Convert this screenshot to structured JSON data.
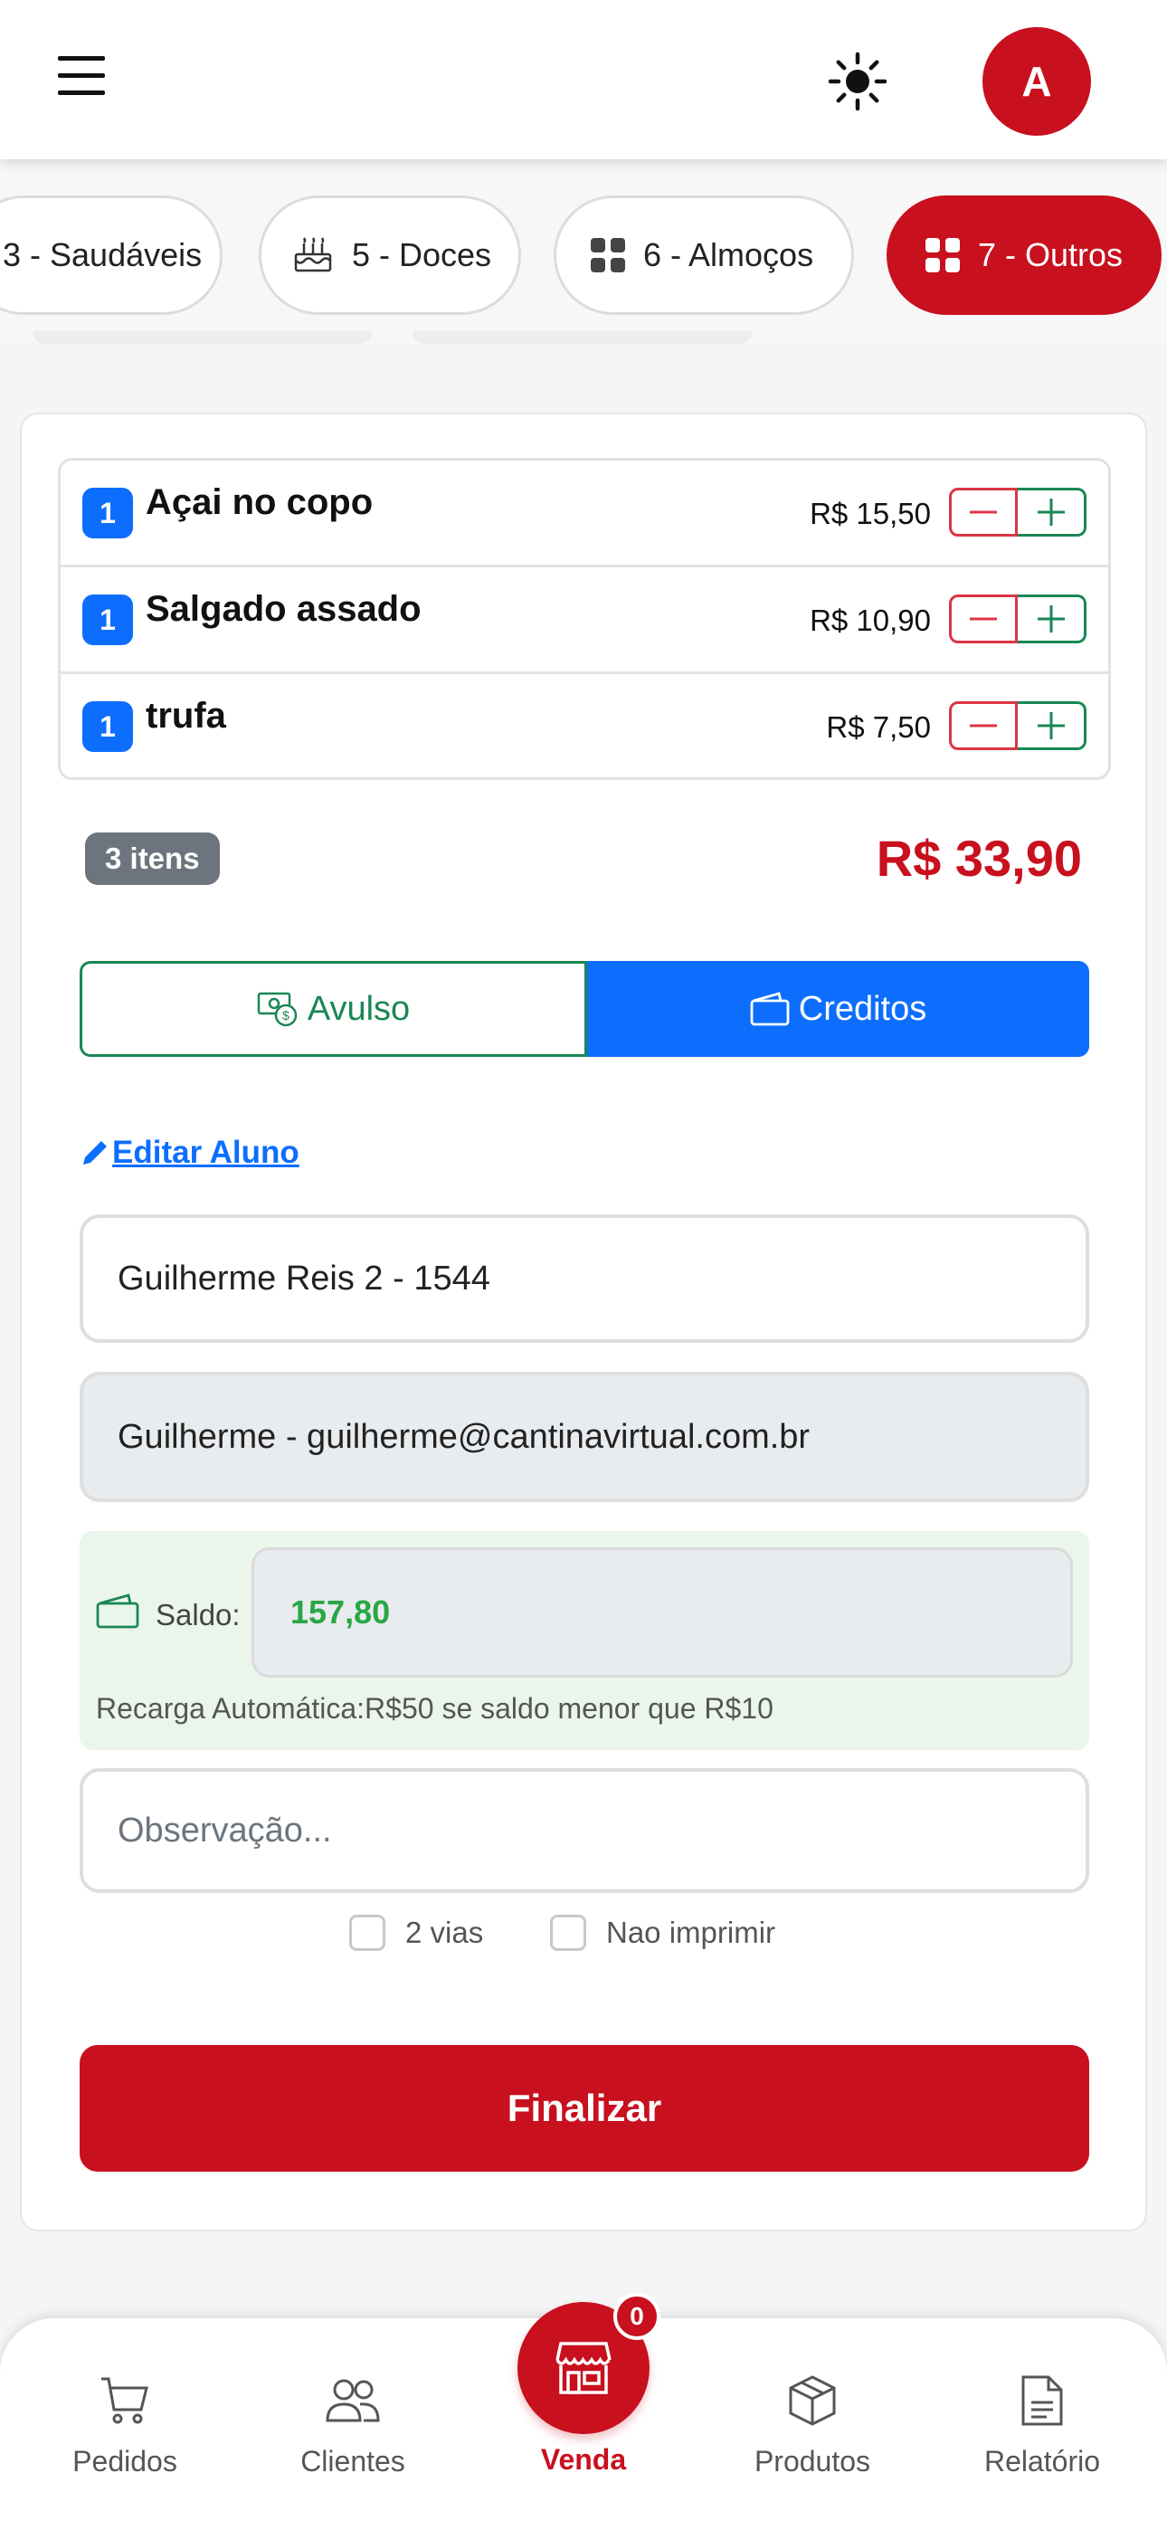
{
  "header": {
    "avatar_initial": "A",
    "menu_icon": "hamburger-icon",
    "theme_icon": "sun-icon"
  },
  "categories": [
    {
      "label": "3 - Saudáveis",
      "icon": "",
      "active": false
    },
    {
      "label": "5 - Doces",
      "icon": "cake-icon",
      "active": false
    },
    {
      "label": "6 - Almoços",
      "icon": "grid-icon",
      "active": false
    },
    {
      "label": "7 - Outros",
      "icon": "grid-icon",
      "active": true
    }
  ],
  "cart": {
    "items": [
      {
        "qty": "1",
        "name": "Açai no copo",
        "price": "R$ 15,50"
      },
      {
        "qty": "1",
        "name": "Salgado assado",
        "price": "R$ 10,90"
      },
      {
        "qty": "1",
        "name": "trufa",
        "price": "R$ 7,50"
      }
    ],
    "count_label": "3 itens",
    "total": "R$ 33,90"
  },
  "payment": {
    "avulso_label": "Avulso",
    "creditos_label": "Creditos",
    "selected": "Creditos"
  },
  "student": {
    "edit_link": "Editar Aluno",
    "name_value": "Guilherme Reis 2 - 1544",
    "guardian_value": "Guilherme  - guilherme@cantinavirtual.com.br",
    "saldo_label": "Saldo:",
    "saldo_value": "157,80",
    "recarga_text": "Recarga Automática:R$50 se saldo menor que R$10"
  },
  "observacao": {
    "placeholder": "Observação..."
  },
  "options": {
    "duas_vias": "2 vias",
    "nao_imprimir": "Nao imprimir"
  },
  "finalizar_label": "Finalizar",
  "bottom_nav": {
    "pedidos": "Pedidos",
    "clientes": "Clientes",
    "venda": "Venda",
    "venda_count": "0",
    "produtos": "Produtos",
    "relatorio": "Relatório"
  },
  "colors": {
    "brand_red": "#c8101e",
    "primary_blue": "#0d6efd",
    "success_green": "#198754"
  }
}
